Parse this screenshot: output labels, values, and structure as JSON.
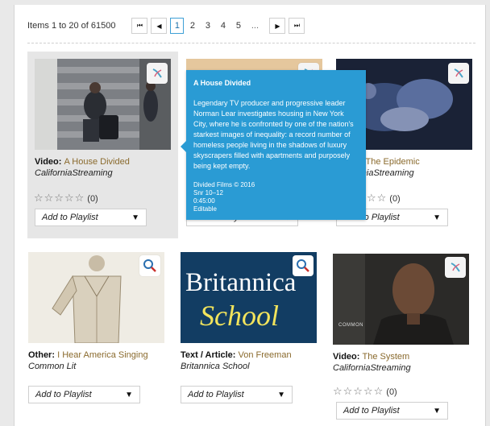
{
  "pager": {
    "count_text": "Items 1 to 20 of 61500",
    "first_glyph": "⏮",
    "prev_glyph": "◀",
    "next_glyph": "▶",
    "last_glyph": "⏭",
    "pages": [
      "1",
      "2",
      "3",
      "4",
      "5"
    ],
    "ellipsis": "...",
    "current": "1"
  },
  "cards": [
    {
      "type": "Video",
      "title": "A House Divided",
      "source": "CaliforniaStreaming",
      "stars": "☆☆☆☆☆",
      "rating_count": "(0)",
      "playlist_label": "Add to Playlist",
      "badge": "streaming-icon"
    },
    {
      "type": "Video",
      "title": "",
      "source": "",
      "stars": "",
      "rating_count": "",
      "playlist_label": "Add to Playlist",
      "badge": "streaming-icon"
    },
    {
      "type": "Video",
      "title": "The Epidemic",
      "source": "CaliforniaStreaming",
      "stars": "☆☆☆☆☆",
      "rating_count": "(0)",
      "playlist_label": "Add to Playlist",
      "badge": "streaming-icon"
    },
    {
      "type": "Other",
      "title": "I Hear America Singing",
      "source": "Common Lit",
      "playlist_label": "Add to Playlist",
      "badge": "zoom-icon"
    },
    {
      "type": "Text / Article",
      "title": "Von Freeman",
      "source": "Britannica School",
      "playlist_label": "Add to Playlist",
      "badge": "zoom-icon",
      "thumb_line1": "Britannica",
      "thumb_line2": "School"
    },
    {
      "type": "Video",
      "title": "The System",
      "source": "CaliforniaStreaming",
      "stars": "☆☆☆☆☆",
      "rating_count": "(0)",
      "playlist_label": "Add to Playlist",
      "badge": "streaming-icon",
      "thumb_caption": "COMMON"
    }
  ],
  "tooltip": {
    "title": "A House Divided",
    "description": "Legendary TV producer and progressive leader Norman Lear investigates housing in New York City, where he is confronted by one of the nation's starkest images of inequality: a record number of homeless people living in the shadows of luxury skyscrapers filled with apartments and purposely being kept empty.",
    "copyright": "Divided Films © 2016",
    "grade": "Snr 10–12",
    "duration": "0:45:00",
    "status": "Editable"
  },
  "colors": {
    "accent": "#2a9bd4",
    "link": "#8a6a2d",
    "britannica_blue": "#123d63",
    "britannica_yellow": "#f2e45c"
  }
}
